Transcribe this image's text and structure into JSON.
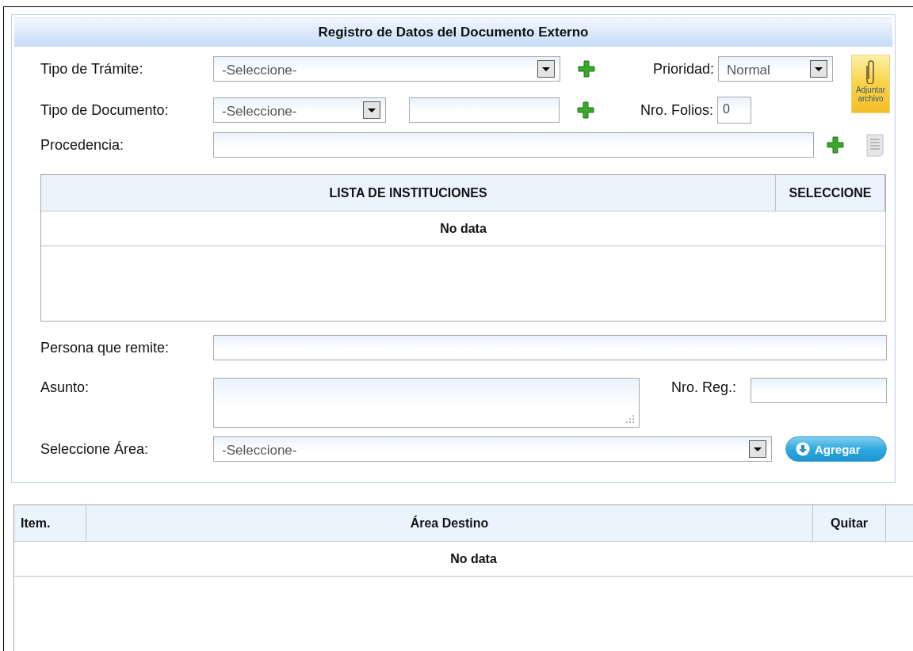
{
  "panel_title": "Registro de Datos del Documento Externo",
  "tipo_tramite": {
    "label": "Tipo de Trámite:",
    "value": "-Seleccione-"
  },
  "prioridad": {
    "label": "Prioridad:",
    "value": "Normal"
  },
  "attach_button": {
    "label": "Adjuntar archivo"
  },
  "tipo_documento": {
    "label": "Tipo de Documento:",
    "value": "-Seleccione-"
  },
  "nro_folios": {
    "label": "Nro. Folios:",
    "value": "0"
  },
  "procedencia": {
    "label": "Procedencia:"
  },
  "instituciones_table": {
    "columns": [
      "LISTA DE INSTITUCIONES",
      "SELECCIONE"
    ],
    "empty_text": "No data"
  },
  "persona_remite": {
    "label": "Persona que remite:"
  },
  "asunto": {
    "label": "Asunto:"
  },
  "nro_reg": {
    "label": "Nro. Reg.:"
  },
  "area": {
    "label": "Seleccione Área:",
    "value": "-Seleccione-"
  },
  "agregar_button": {
    "label": "Agregar"
  },
  "destinos_table": {
    "columns": [
      "Item.",
      "Área Destino",
      "Quitar"
    ],
    "empty_text": "No data"
  }
}
